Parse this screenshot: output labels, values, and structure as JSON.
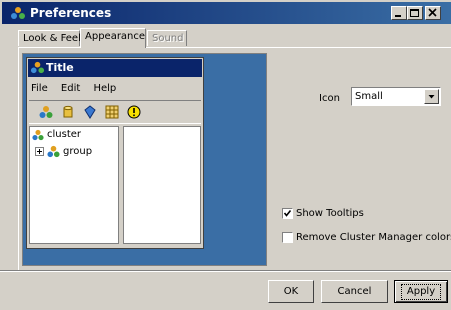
{
  "window": {
    "title": "Preferences"
  },
  "tabs": [
    {
      "label": "Look & Feel",
      "state": "normal"
    },
    {
      "label": "Appearance",
      "state": "active"
    },
    {
      "label": "Sound",
      "state": "disabled"
    }
  ],
  "preview": {
    "title": "Title",
    "menu": [
      "File",
      "Edit",
      "Help"
    ],
    "toolbar_icons": [
      "cluster-icon",
      "database-icon",
      "gem-icon",
      "grid-icon",
      "warning-icon"
    ],
    "tree": [
      {
        "label": "cluster",
        "icon": "cluster-icon"
      },
      {
        "label": "group",
        "icon": "group-icon",
        "expander": "plus"
      }
    ]
  },
  "settings": {
    "icon_label": "Icon",
    "icon_size_value": "Small",
    "show_tooltips_label": "Show Tooltips",
    "show_tooltips_checked": true,
    "remove_colors_label": "Remove Cluster Manager colors",
    "remove_colors_checked": false
  },
  "buttons": {
    "ok": "OK",
    "cancel": "Cancel",
    "apply": "Apply"
  },
  "colors": {
    "titlebar": "#0a246a",
    "preview_bg": "#3a6ea5",
    "face": "#d4d0c8"
  }
}
